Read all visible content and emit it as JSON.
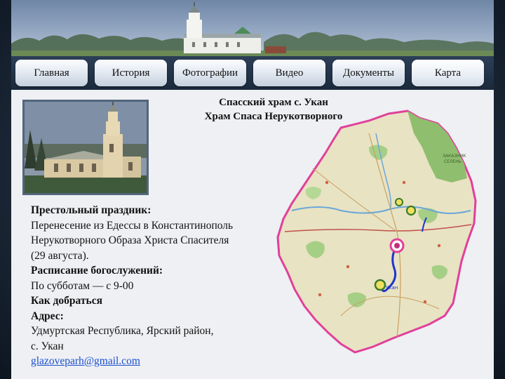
{
  "nav": {
    "tabs": [
      {
        "label": "Главная"
      },
      {
        "label": "История"
      },
      {
        "label": "Фотографии"
      },
      {
        "label": "Видео"
      },
      {
        "label": "Документы"
      },
      {
        "label": "Карта",
        "active": true
      }
    ]
  },
  "content": {
    "title_line1": "Спасский храм с. Укан",
    "title_line2": "Храм Спаса Нерукотворного",
    "feast_heading": "Престольный праздник:",
    "feast_text_1": "Перенесение из Едессы в Константинополь",
    "feast_text_2": "Нерукотворного Образа Христа Спасителя",
    "feast_text_3": "(29 августа).",
    "schedule_heading": "Расписание богослужений:",
    "schedule_text": "По субботам — с 9-00",
    "directions_heading": "Как добраться",
    "address_heading": "Адрес:",
    "address_line1": "Удмуртская Республика, Ярский район,",
    "address_line2": "с. Укан",
    "email": "glazoveparh@gmail.com"
  },
  "map": {
    "marker_label": "Укан",
    "region_label_1": "ЗАКАЗНИК",
    "region_label_2": "СЕЛЕНЬ"
  },
  "colors": {
    "nav_bg": "#1b2a3c",
    "link": "#1a4fd0",
    "map_border": "#e0409a",
    "map_land": "#e6e2c4",
    "forest": "#8fbe6e",
    "route": "#2233cc"
  }
}
